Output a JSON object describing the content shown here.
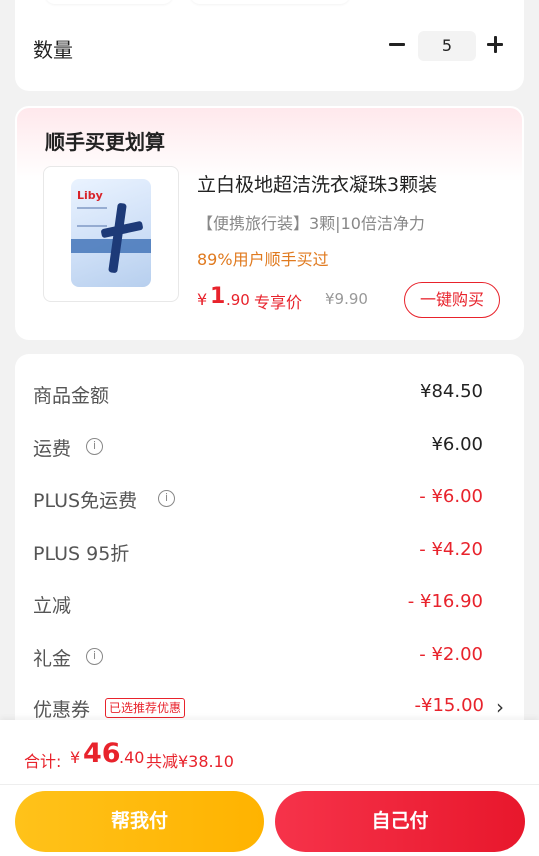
{
  "quantity": {
    "label": "数量",
    "value": "5"
  },
  "addon": {
    "title": "顺手买更划算",
    "product": {
      "name": "立白极地超洁洗衣凝珠3颗装",
      "subtitle": "【便携旅行装】3颗|10倍洁净力",
      "social_proof": "89%用户顺手买过",
      "price_symbol": "¥",
      "price_int": "1",
      "price_dec": ".90",
      "price_tag": "专享价",
      "original_price": "¥9.90",
      "brand": "Liby",
      "buy_button": "一键购买"
    }
  },
  "summary": {
    "rows": [
      {
        "label": "商品金额",
        "value": "¥84.50"
      },
      {
        "label": "运费",
        "value": "¥6.00"
      },
      {
        "label": "PLUS免运费",
        "value": "- ¥6.00"
      },
      {
        "label": "PLUS 95折",
        "value": "- ¥4.20"
      },
      {
        "label": "立减",
        "value": "- ¥16.90"
      },
      {
        "label": "礼金",
        "value": "- ¥2.00"
      },
      {
        "label": "优惠券",
        "value": "-¥15.00",
        "badge": "已选推荐优惠"
      }
    ]
  },
  "bottom": {
    "total_label": "合计:",
    "total_symbol": "¥",
    "total_int": "46",
    "total_dec": ".40",
    "saved": "共减¥38.10",
    "help_pay": "帮我付",
    "self_pay": "自己付"
  },
  "colors": {
    "accent_red": "#e8232c",
    "accent_orange": "#e07a1f",
    "help_pay_yellow": "#ffb300"
  }
}
